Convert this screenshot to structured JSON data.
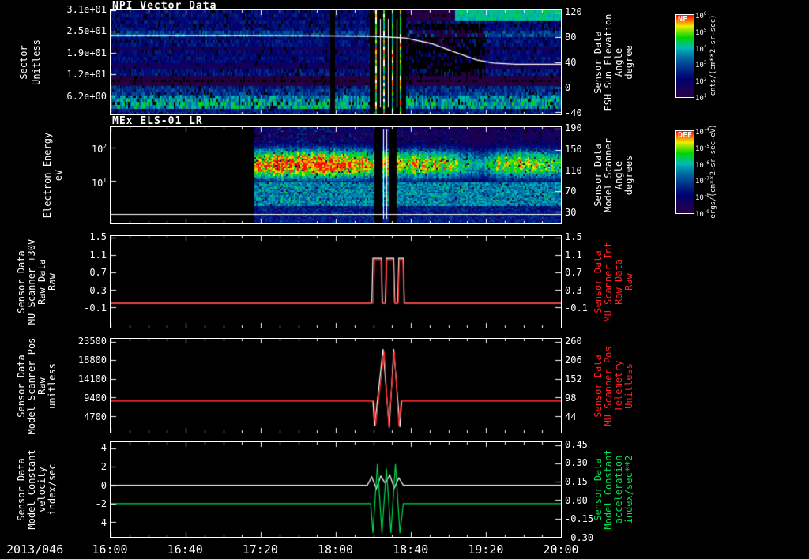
{
  "page": {
    "bg": "#000000",
    "date_label": "2013/046",
    "time_ticks": [
      "16:00",
      "16:40",
      "17:20",
      "18:00",
      "18:40",
      "19:20",
      "20:00"
    ]
  },
  "panels": [
    {
      "title": "NPI Vector Data",
      "left_label_lines": [
        "Sector",
        "Unitless"
      ],
      "left_ticks": [
        "3.1e+01",
        "2.5e+01",
        "1.9e+01",
        "1.2e+01",
        "6.2e+00"
      ],
      "right_ticks": [
        "120",
        "80",
        "40",
        "0",
        "-40"
      ],
      "right_label_lines": [
        "Sensor Data",
        "ESH Sun Elevation",
        "Angle",
        "degree"
      ],
      "right_label_color": "#ffffff",
      "colorbar": {
        "name": "NF",
        "units": "cnts/(cm**2-sr-sec)",
        "tick_exponents": [
          "6",
          "5",
          "4",
          "3",
          "2",
          "1"
        ]
      }
    },
    {
      "title": "MEx ELS-01 LR",
      "left_label_lines": [
        "Electron Energy",
        "eV"
      ],
      "left_ticks": [
        "10^2",
        "10^1"
      ],
      "right_ticks": [
        "190",
        "150",
        "110",
        "70",
        "30"
      ],
      "right_label_lines": [
        "Sensor Data",
        "Model Scanner",
        "Angle",
        "degrees"
      ],
      "right_label_color": "#ffffff",
      "colorbar": {
        "name": "DEF",
        "units": "ergs/(cm**2-sr-sec-eV)",
        "tick_exponents": [
          "-4",
          "-5",
          "-6",
          "-7",
          "-8",
          "-9"
        ]
      }
    },
    {
      "title": "",
      "left_label_lines": [
        "Sensor Data",
        "MU Scanner +30V",
        "Raw Data",
        "Raw"
      ],
      "left_ticks": [
        "1.5",
        "1.1",
        "0.7",
        "0.3",
        "-0.1"
      ],
      "right_ticks": [
        "1.5",
        "1.1",
        "0.7",
        "0.3",
        "-0.1"
      ],
      "right_label_lines": [
        "Sensor Data",
        "MU Scanner Int",
        "Raw Data",
        "Raw"
      ],
      "right_label_color": "#ff2222"
    },
    {
      "title": "",
      "left_label_lines": [
        "Sensor Data",
        "Model Scanner Pos",
        "Raw",
        "unitless"
      ],
      "left_ticks": [
        "23500",
        "18800",
        "14100",
        "9400",
        "4700"
      ],
      "right_ticks": [
        "260",
        "206",
        "152",
        "98",
        "44"
      ],
      "right_label_lines": [
        "Sensor Data",
        "MU Scanner Pos",
        "Telemetry",
        "Unitless"
      ],
      "right_label_color": "#ff2222"
    },
    {
      "title": "",
      "left_label_lines": [
        "Sensor Data",
        "Model Constant",
        "velocity",
        "index/sec"
      ],
      "left_ticks": [
        "4",
        "2",
        "0",
        "-2",
        "-4"
      ],
      "right_ticks": [
        "0.45",
        "0.30",
        "0.15",
        "0.00",
        "-0.15",
        "-0.30"
      ],
      "right_label_lines": [
        "Sensor Data",
        "Model Constant",
        "acceleration",
        "index/sec**2"
      ],
      "right_label_color": "#00e050"
    }
  ],
  "chart_data": [
    {
      "type": "heatmap",
      "title": "NPI Vector Data",
      "x_range_hours": [
        16,
        20
      ],
      "y_axis": {
        "label": "Sector (Unitless)",
        "tick_values": [
          31,
          25,
          19,
          12,
          6.2
        ]
      },
      "right_axis": {
        "label": "ESH Sun Elevation Angle (degree)",
        "range": [
          -40,
          120
        ]
      },
      "row_intensity_bottom_to_top": [
        0.35,
        0.35,
        0.6,
        0.62,
        0.6,
        0.55,
        0.42,
        0.4,
        0.38,
        0.06,
        0.05,
        0.08,
        0.35,
        0.33,
        0.2,
        0.22,
        0.3,
        0.32,
        0.28,
        0.3,
        0.18,
        0.32,
        0.34,
        0.3,
        0.45,
        0.42,
        0.32,
        0.3,
        0.33,
        0.28,
        0.32,
        0.3
      ],
      "gaps": [
        [
          17.94,
          17.99
        ],
        [
          18.3,
          18.62
        ]
      ],
      "event_stripes": [
        18.35,
        18.42,
        18.5,
        18.57
      ],
      "white_vlines": [
        18.39,
        18.46,
        18.54
      ],
      "post_event_dark": {
        "x_range": [
          18.62,
          19.32
        ],
        "rows": [
          12,
          27
        ]
      },
      "top_cyan_band": {
        "x_range": [
          19.05,
          20.0
        ],
        "rows": [
          29,
          31
        ],
        "intensity": 0.6
      },
      "overlay_line": {
        "color": "#ffffff",
        "axis": "right",
        "points": [
          [
            16,
            83
          ],
          [
            17.2,
            83
          ],
          [
            18.3,
            82
          ],
          [
            18.62,
            79
          ],
          [
            18.85,
            70
          ],
          [
            19.05,
            57
          ],
          [
            19.25,
            44
          ],
          [
            19.4,
            39
          ],
          [
            19.6,
            37
          ],
          [
            20,
            37
          ]
        ]
      }
    },
    {
      "type": "heatmap",
      "title": "MEx ELS-01 LR",
      "x_range_hours": [
        16,
        20
      ],
      "y_axis": {
        "label": "Electron Energy (eV)",
        "scale": "log",
        "ylim_log": [
          -0.3,
          2.6
        ]
      },
      "right_axis": {
        "label": "Model Scanner Angle (degrees)",
        "tick_values": [
          190,
          150,
          110,
          70,
          30
        ]
      },
      "data_start_hour": 17.27,
      "gaps": [
        [
          18.33,
          18.41
        ],
        [
          18.46,
          18.53
        ]
      ],
      "white_vlines": [
        18.42,
        18.45
      ],
      "band": {
        "center_log": 1.5,
        "sigma_log": 0.4
      },
      "amplitude_profile": [
        [
          17.27,
          0.9
        ],
        [
          17.4,
          1.0
        ],
        [
          17.9,
          1.0
        ],
        [
          18.15,
          0.95
        ],
        [
          18.33,
          0.9
        ],
        [
          18.56,
          0.84
        ],
        [
          18.8,
          0.88
        ],
        [
          19.0,
          0.8
        ],
        [
          19.15,
          0.65
        ],
        [
          19.3,
          0.6
        ],
        [
          19.45,
          0.8
        ],
        [
          19.65,
          0.84
        ],
        [
          19.85,
          0.78
        ],
        [
          20.0,
          0.7
        ]
      ],
      "low_energy_floor": 0.5,
      "bottom_white_line_frac": 0.9
    },
    {
      "type": "line",
      "x_range_hours": [
        16,
        20
      ],
      "ylim": [
        -0.52,
        1.5
      ],
      "series": [
        {
          "name": "MU Scanner +30V Raw Data Raw",
          "color": "#ffffff",
          "points": [
            [
              16,
              0
            ],
            [
              18.32,
              0
            ],
            [
              18.33,
              1.03
            ],
            [
              18.405,
              1.03
            ],
            [
              18.415,
              0
            ],
            [
              18.44,
              0
            ],
            [
              18.45,
              1.03
            ],
            [
              18.515,
              1.03
            ],
            [
              18.525,
              0
            ],
            [
              18.55,
              0
            ],
            [
              18.56,
              1.03
            ],
            [
              18.6,
              1.03
            ],
            [
              18.61,
              0
            ],
            [
              20,
              0
            ]
          ]
        },
        {
          "name": "MU Scanner Int Raw Data Raw",
          "color": "#ff2222",
          "points": [
            [
              16,
              0
            ],
            [
              18.335,
              0
            ],
            [
              18.345,
              1.0
            ],
            [
              18.4,
              1.0
            ],
            [
              18.41,
              0
            ],
            [
              18.445,
              0
            ],
            [
              18.455,
              1.0
            ],
            [
              18.51,
              1.0
            ],
            [
              18.52,
              0
            ],
            [
              18.555,
              0
            ],
            [
              18.565,
              1.0
            ],
            [
              18.595,
              1.0
            ],
            [
              18.605,
              0
            ],
            [
              20,
              0
            ]
          ]
        }
      ]
    },
    {
      "type": "line",
      "x_range_hours": [
        16,
        20
      ],
      "ylim": [
        700,
        23500
      ],
      "series": [
        {
          "name": "Model Scanner Pos Raw",
          "color": "#ffffff",
          "points": [
            [
              16,
              8600
            ],
            [
              18.33,
              8600
            ],
            [
              18.345,
              2200
            ],
            [
              18.42,
              21600
            ],
            [
              18.475,
              1800
            ],
            [
              18.515,
              21600
            ],
            [
              18.57,
              2000
            ],
            [
              18.585,
              8600
            ],
            [
              20,
              8600
            ]
          ]
        },
        {
          "name": "MU Scanner Pos Telemetry",
          "color": "#ff2222",
          "points": [
            [
              16,
              8600
            ],
            [
              18.34,
              8600
            ],
            [
              18.355,
              2500
            ],
            [
              18.43,
              21000
            ],
            [
              18.47,
              2200
            ],
            [
              18.52,
              21000
            ],
            [
              18.56,
              2400
            ],
            [
              18.58,
              8600
            ],
            [
              20,
              8600
            ]
          ]
        }
      ]
    },
    {
      "type": "line",
      "x_range_hours": [
        16,
        20
      ],
      "ylim": [
        -5.5,
        4
      ],
      "series": [
        {
          "name": "Model Constant velocity",
          "color": "#ffffff",
          "points": [
            [
              16,
              0
            ],
            [
              18.28,
              0
            ],
            [
              18.32,
              0.9
            ],
            [
              18.36,
              -0.4
            ],
            [
              18.4,
              1.0
            ],
            [
              18.44,
              0.2
            ],
            [
              18.48,
              1.1
            ],
            [
              18.52,
              -0.3
            ],
            [
              18.56,
              0.8
            ],
            [
              18.6,
              0
            ],
            [
              20,
              0
            ]
          ]
        },
        {
          "name": "Model Constant acceleration",
          "color": "#00e050",
          "points": [
            [
              16,
              -2
            ],
            [
              18.31,
              -2
            ],
            [
              18.33,
              -5.2
            ],
            [
              18.37,
              2.3
            ],
            [
              18.41,
              -5.2
            ],
            [
              18.45,
              1.8
            ],
            [
              18.49,
              -5.2
            ],
            [
              18.53,
              2.3
            ],
            [
              18.57,
              -5.2
            ],
            [
              18.6,
              -2
            ],
            [
              20,
              -2
            ]
          ]
        }
      ]
    }
  ]
}
